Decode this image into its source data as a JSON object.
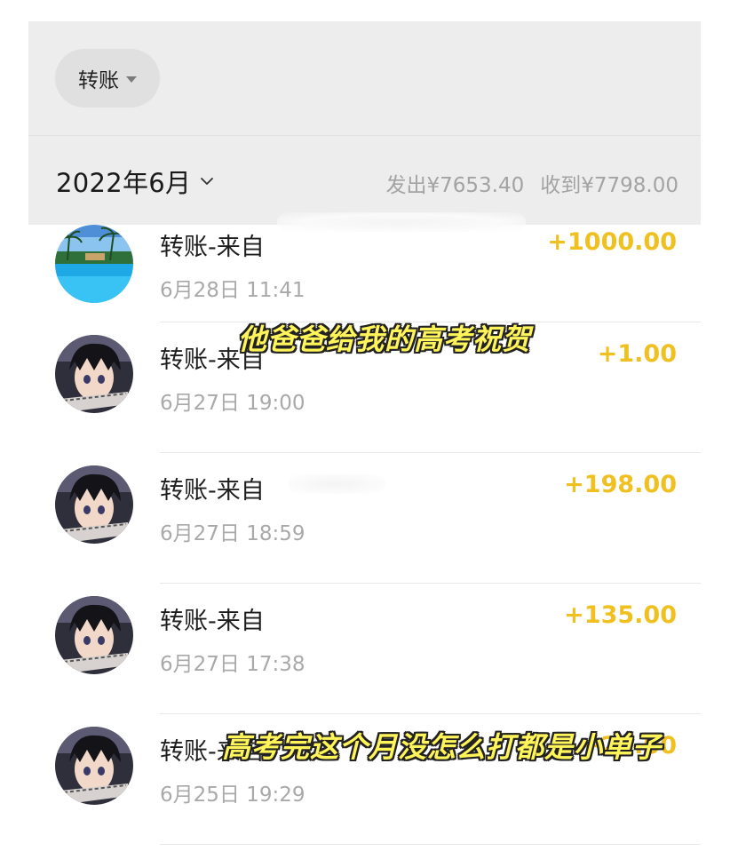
{
  "filter": {
    "label": "转账"
  },
  "month_bar": {
    "month": "2022年6月",
    "spent": "发出¥7653.40",
    "received": "收到¥7798.00"
  },
  "transactions": [
    {
      "title": "转账-来自",
      "time": "6月28日 11:41",
      "amount": "+1000.00",
      "avatar": "beach-avatar"
    },
    {
      "title": "转账-来自",
      "time": "6月27日 19:00",
      "amount": "+1.00",
      "avatar": "anime-avatar"
    },
    {
      "title": "转账-来自",
      "time": "6月27日 18:59",
      "amount": "+198.00",
      "avatar": "anime-avatar"
    },
    {
      "title": "转账-来自",
      "time": "6月27日 17:38",
      "amount": "+135.00",
      "avatar": "anime-avatar"
    },
    {
      "title": "转账-来自",
      "time": "6月25日 19:29",
      "amount": "+20.00",
      "avatar": "anime-avatar"
    }
  ],
  "captions": {
    "top": "他爸爸给我的高考祝贺",
    "bottom": "高考完这个月没怎么打都是小单子"
  },
  "colors": {
    "amount": "#f0c020",
    "caption_fill": "#fff45a",
    "header_bg": "#ededed"
  }
}
